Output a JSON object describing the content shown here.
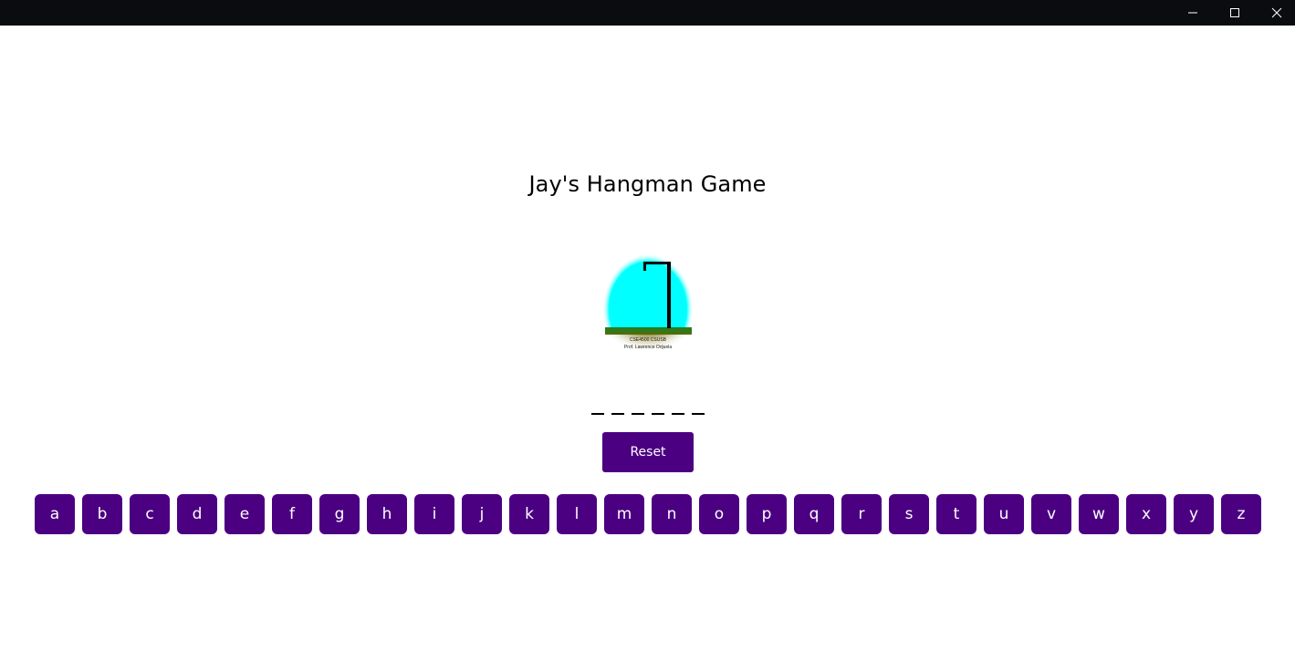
{
  "window": {
    "controls": {
      "minimize_icon": "minimize-icon",
      "maximize_icon": "maximize-icon",
      "close_icon": "close-icon"
    }
  },
  "title": "Jay's Hangman Game",
  "image": {
    "caption_line1": "CSE4500 CSUSB",
    "caption_line2": "Prof. Lawrence Orijuela"
  },
  "word": {
    "blank_count": 6
  },
  "reset_label": "Reset",
  "keyboard": {
    "letters": [
      "a",
      "b",
      "c",
      "d",
      "e",
      "f",
      "g",
      "h",
      "i",
      "j",
      "k",
      "l",
      "m",
      "n",
      "o",
      "p",
      "q",
      "r",
      "s",
      "t",
      "u",
      "v",
      "w",
      "x",
      "y",
      "z"
    ]
  },
  "colors": {
    "button_bg": "#4b0082",
    "button_text": "#ffffff",
    "titlebar": "#0b0c10",
    "sky": "#00ffff",
    "grass": "#2e7d1f",
    "ground": "#807000"
  }
}
